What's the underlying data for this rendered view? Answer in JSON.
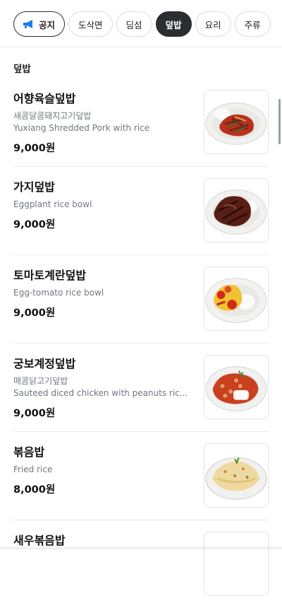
{
  "tabs": [
    {
      "label": "공지",
      "icon": "megaphone-icon",
      "style": "notice"
    },
    {
      "label": "도삭면",
      "style": "normal"
    },
    {
      "label": "딤섬",
      "style": "normal"
    },
    {
      "label": "덮밥",
      "style": "active"
    },
    {
      "label": "요리",
      "style": "normal"
    },
    {
      "label": "주류",
      "style": "normal"
    }
  ],
  "colors": {
    "accent_active": "#2b2d31",
    "megaphone": "#1e7cf5",
    "secondary_text": "#707680"
  },
  "section": {
    "title": "덮밥"
  },
  "items": [
    {
      "name": "어향육슬덮밥",
      "desc_ko": "새콤달콤돼지고기덮밥",
      "desc_en": "Yuxiang Shredded Pork with rice",
      "price": "9,000원"
    },
    {
      "name": "가지덮밥",
      "desc_ko": "",
      "desc_en": "Eggplant rice bowl",
      "price": "9,000원"
    },
    {
      "name": "토마토계란덮밥",
      "desc_ko": "",
      "desc_en": "Egg-tomato rice bowl",
      "price": "9,000원"
    },
    {
      "name": "궁보계정덮밥",
      "desc_ko": "매콤닭고기덮밥",
      "desc_en": "Sauteed diced chicken with peanuts ric...",
      "price": "9,000원"
    },
    {
      "name": "볶음밥",
      "desc_ko": "",
      "desc_en": "Fried rice",
      "price": "8,000원"
    },
    {
      "name": "새우볶음밥",
      "desc_ko": "",
      "desc_en": "",
      "price": ""
    }
  ]
}
